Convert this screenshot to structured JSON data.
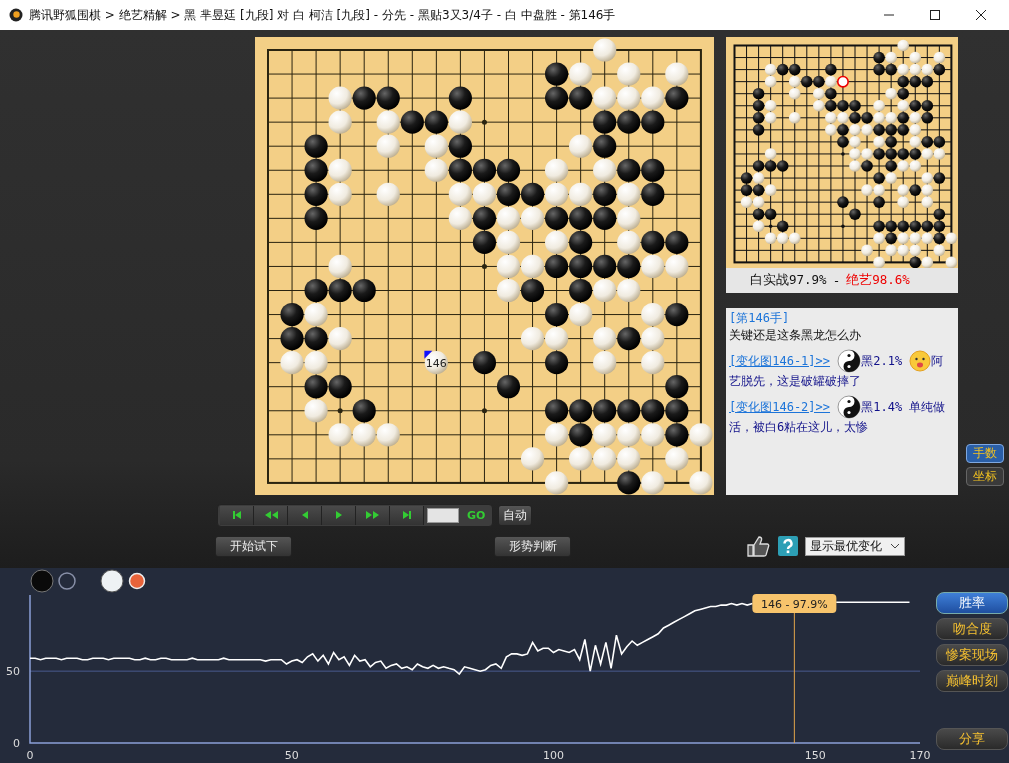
{
  "window": {
    "title": "腾讯野狐围棋 > 绝艺精解 > 黑 芈昱廷 [九段] 对 白 柯洁 [九段] - 分先 - 黑贴3又3/4子 - 白 中盘胜 - 第146手"
  },
  "board": {
    "last_move_label": "146",
    "rows": [
      {
        "cells": [
          {
            "kind": "e"
          },
          {
            "kind": "e"
          },
          {
            "kind": "e"
          },
          {
            "kind": "e"
          },
          {
            "kind": "e"
          },
          {
            "kind": "e"
          },
          {
            "kind": "e"
          },
          {
            "kind": "e"
          },
          {
            "kind": "e"
          },
          {
            "kind": "e"
          },
          {
            "kind": "e"
          },
          {
            "kind": "e"
          },
          {
            "kind": "e"
          },
          {
            "kind": "e"
          },
          {
            "kind": "w"
          },
          {
            "kind": "e"
          },
          {
            "kind": "e"
          },
          {
            "kind": "e"
          },
          {
            "kind": "e"
          }
        ]
      },
      {
        "cells": [
          {
            "kind": "e"
          },
          {
            "kind": "e"
          },
          {
            "kind": "e"
          },
          {
            "kind": "e"
          },
          {
            "kind": "e"
          },
          {
            "kind": "e"
          },
          {
            "kind": "e"
          },
          {
            "kind": "e"
          },
          {
            "kind": "e"
          },
          {
            "kind": "e"
          },
          {
            "kind": "e"
          },
          {
            "kind": "e"
          },
          {
            "kind": "b"
          },
          {
            "kind": "w"
          },
          {
            "kind": "e"
          },
          {
            "kind": "w"
          },
          {
            "kind": "e"
          },
          {
            "kind": "w"
          },
          {
            "kind": "e"
          }
        ]
      },
      {
        "cells": [
          {
            "kind": "e"
          },
          {
            "kind": "e"
          },
          {
            "kind": "e"
          },
          {
            "kind": "w"
          },
          {
            "kind": "b"
          },
          {
            "kind": "b"
          },
          {
            "kind": "e"
          },
          {
            "kind": "e"
          },
          {
            "kind": "b"
          },
          {
            "kind": "e"
          },
          {
            "kind": "e"
          },
          {
            "kind": "e"
          },
          {
            "kind": "b"
          },
          {
            "kind": "b"
          },
          {
            "kind": "w"
          },
          {
            "kind": "w"
          },
          {
            "kind": "w"
          },
          {
            "kind": "b"
          },
          {
            "kind": "e"
          }
        ]
      },
      {
        "cells": [
          {
            "kind": "e"
          },
          {
            "kind": "e"
          },
          {
            "kind": "e"
          },
          {
            "kind": "w"
          },
          {
            "kind": "e"
          },
          {
            "kind": "w"
          },
          {
            "kind": "b"
          },
          {
            "kind": "b"
          },
          {
            "kind": "w"
          },
          {
            "kind": "x"
          },
          {
            "kind": "e"
          },
          {
            "kind": "e"
          },
          {
            "kind": "e"
          },
          {
            "kind": "e"
          },
          {
            "kind": "b"
          },
          {
            "kind": "b"
          },
          {
            "kind": "b"
          },
          {
            "kind": "e"
          },
          {
            "kind": "e"
          }
        ]
      },
      {
        "cells": [
          {
            "kind": "e"
          },
          {
            "kind": "e"
          },
          {
            "kind": "b"
          },
          {
            "kind": "e"
          },
          {
            "kind": "e"
          },
          {
            "kind": "w"
          },
          {
            "kind": "e"
          },
          {
            "kind": "w"
          },
          {
            "kind": "b"
          },
          {
            "kind": "e"
          },
          {
            "kind": "e"
          },
          {
            "kind": "e"
          },
          {
            "kind": "e"
          },
          {
            "kind": "w"
          },
          {
            "kind": "b"
          },
          {
            "kind": "e"
          },
          {
            "kind": "e"
          },
          {
            "kind": "e"
          },
          {
            "kind": "e"
          }
        ]
      },
      {
        "cells": [
          {
            "kind": "e"
          },
          {
            "kind": "e"
          },
          {
            "kind": "b"
          },
          {
            "kind": "w"
          },
          {
            "kind": "e"
          },
          {
            "kind": "e"
          },
          {
            "kind": "e"
          },
          {
            "kind": "w"
          },
          {
            "kind": "b"
          },
          {
            "kind": "b"
          },
          {
            "kind": "b"
          },
          {
            "kind": "e"
          },
          {
            "kind": "w"
          },
          {
            "kind": "e"
          },
          {
            "kind": "w"
          },
          {
            "kind": "b"
          },
          {
            "kind": "b"
          },
          {
            "kind": "e"
          },
          {
            "kind": "e"
          }
        ]
      },
      {
        "cells": [
          {
            "kind": "e"
          },
          {
            "kind": "e"
          },
          {
            "kind": "b"
          },
          {
            "kind": "w"
          },
          {
            "kind": "e"
          },
          {
            "kind": "w"
          },
          {
            "kind": "e"
          },
          {
            "kind": "e"
          },
          {
            "kind": "w"
          },
          {
            "kind": "w"
          },
          {
            "kind": "b"
          },
          {
            "kind": "b"
          },
          {
            "kind": "w"
          },
          {
            "kind": "w"
          },
          {
            "kind": "b"
          },
          {
            "kind": "w"
          },
          {
            "kind": "b"
          },
          {
            "kind": "e"
          },
          {
            "kind": "e"
          }
        ]
      },
      {
        "cells": [
          {
            "kind": "e"
          },
          {
            "kind": "e"
          },
          {
            "kind": "b"
          },
          {
            "kind": "e"
          },
          {
            "kind": "e"
          },
          {
            "kind": "e"
          },
          {
            "kind": "e"
          },
          {
            "kind": "e"
          },
          {
            "kind": "w"
          },
          {
            "kind": "b"
          },
          {
            "kind": "w"
          },
          {
            "kind": "w"
          },
          {
            "kind": "b"
          },
          {
            "kind": "b"
          },
          {
            "kind": "b"
          },
          {
            "kind": "w"
          },
          {
            "kind": "e"
          },
          {
            "kind": "e"
          },
          {
            "kind": "e"
          }
        ]
      },
      {
        "cells": [
          {
            "kind": "e"
          },
          {
            "kind": "e"
          },
          {
            "kind": "e"
          },
          {
            "kind": "e"
          },
          {
            "kind": "e"
          },
          {
            "kind": "e"
          },
          {
            "kind": "e"
          },
          {
            "kind": "e"
          },
          {
            "kind": "e"
          },
          {
            "kind": "b"
          },
          {
            "kind": "w"
          },
          {
            "kind": "e"
          },
          {
            "kind": "w"
          },
          {
            "kind": "b"
          },
          {
            "kind": "e"
          },
          {
            "kind": "w"
          },
          {
            "kind": "b"
          },
          {
            "kind": "b"
          },
          {
            "kind": "e"
          }
        ]
      },
      {
        "cells": [
          {
            "kind": "e"
          },
          {
            "kind": "e"
          },
          {
            "kind": "e"
          },
          {
            "kind": "w"
          },
          {
            "kind": "e"
          },
          {
            "kind": "e"
          },
          {
            "kind": "e"
          },
          {
            "kind": "e"
          },
          {
            "kind": "e"
          },
          {
            "kind": "e"
          },
          {
            "kind": "w"
          },
          {
            "kind": "w"
          },
          {
            "kind": "b"
          },
          {
            "kind": "b"
          },
          {
            "kind": "b"
          },
          {
            "kind": "b"
          },
          {
            "kind": "w"
          },
          {
            "kind": "w"
          },
          {
            "kind": "e"
          }
        ]
      },
      {
        "cells": [
          {
            "kind": "e"
          },
          {
            "kind": "e"
          },
          {
            "kind": "b"
          },
          {
            "kind": "b"
          },
          {
            "kind": "b"
          },
          {
            "kind": "e"
          },
          {
            "kind": "e"
          },
          {
            "kind": "e"
          },
          {
            "kind": "e"
          },
          {
            "kind": "e"
          },
          {
            "kind": "w"
          },
          {
            "kind": "b"
          },
          {
            "kind": "e"
          },
          {
            "kind": "b"
          },
          {
            "kind": "w"
          },
          {
            "kind": "w"
          },
          {
            "kind": "e"
          },
          {
            "kind": "e"
          },
          {
            "kind": "e"
          }
        ]
      },
      {
        "cells": [
          {
            "kind": "e"
          },
          {
            "kind": "b"
          },
          {
            "kind": "w"
          },
          {
            "kind": "e"
          },
          {
            "kind": "e"
          },
          {
            "kind": "e"
          },
          {
            "kind": "e"
          },
          {
            "kind": "e"
          },
          {
            "kind": "e"
          },
          {
            "kind": "e"
          },
          {
            "kind": "e"
          },
          {
            "kind": "e"
          },
          {
            "kind": "b"
          },
          {
            "kind": "w"
          },
          {
            "kind": "e"
          },
          {
            "kind": "e"
          },
          {
            "kind": "w"
          },
          {
            "kind": "b"
          },
          {
            "kind": "e"
          }
        ]
      },
      {
        "cells": [
          {
            "kind": "e"
          },
          {
            "kind": "b"
          },
          {
            "kind": "b"
          },
          {
            "kind": "w"
          },
          {
            "kind": "e"
          },
          {
            "kind": "e"
          },
          {
            "kind": "e"
          },
          {
            "kind": "e"
          },
          {
            "kind": "e"
          },
          {
            "kind": "e"
          },
          {
            "kind": "e"
          },
          {
            "kind": "w"
          },
          {
            "kind": "w"
          },
          {
            "kind": "e"
          },
          {
            "kind": "w"
          },
          {
            "kind": "b"
          },
          {
            "kind": "w"
          },
          {
            "kind": "e"
          },
          {
            "kind": "e"
          }
        ]
      },
      {
        "cells": [
          {
            "kind": "e"
          },
          {
            "kind": "w"
          },
          {
            "kind": "w"
          },
          {
            "kind": "e"
          },
          {
            "kind": "e"
          },
          {
            "kind": "e"
          },
          {
            "kind": "e"
          },
          {
            "kind": "L"
          },
          {
            "kind": "e"
          },
          {
            "kind": "b"
          },
          {
            "kind": "e"
          },
          {
            "kind": "e"
          },
          {
            "kind": "b"
          },
          {
            "kind": "e"
          },
          {
            "kind": "w"
          },
          {
            "kind": "e"
          },
          {
            "kind": "w"
          },
          {
            "kind": "e"
          },
          {
            "kind": "e"
          }
        ]
      },
      {
        "cells": [
          {
            "kind": "e"
          },
          {
            "kind": "e"
          },
          {
            "kind": "b"
          },
          {
            "kind": "b"
          },
          {
            "kind": "e"
          },
          {
            "kind": "e"
          },
          {
            "kind": "e"
          },
          {
            "kind": "e"
          },
          {
            "kind": "e"
          },
          {
            "kind": "e"
          },
          {
            "kind": "b"
          },
          {
            "kind": "e"
          },
          {
            "kind": "e"
          },
          {
            "kind": "e"
          },
          {
            "kind": "e"
          },
          {
            "kind": "e"
          },
          {
            "kind": "e"
          },
          {
            "kind": "b"
          },
          {
            "kind": "e"
          }
        ]
      },
      {
        "cells": [
          {
            "kind": "e"
          },
          {
            "kind": "e"
          },
          {
            "kind": "w"
          },
          {
            "kind": "e"
          },
          {
            "kind": "b"
          },
          {
            "kind": "e"
          },
          {
            "kind": "e"
          },
          {
            "kind": "e"
          },
          {
            "kind": "e"
          },
          {
            "kind": "e"
          },
          {
            "kind": "e"
          },
          {
            "kind": "e"
          },
          {
            "kind": "b"
          },
          {
            "kind": "b"
          },
          {
            "kind": "b"
          },
          {
            "kind": "b"
          },
          {
            "kind": "b"
          },
          {
            "kind": "b"
          },
          {
            "kind": "e"
          }
        ]
      },
      {
        "cells": [
          {
            "kind": "e"
          },
          {
            "kind": "e"
          },
          {
            "kind": "e"
          },
          {
            "kind": "w"
          },
          {
            "kind": "w"
          },
          {
            "kind": "w"
          },
          {
            "kind": "e"
          },
          {
            "kind": "e"
          },
          {
            "kind": "e"
          },
          {
            "kind": "e"
          },
          {
            "kind": "e"
          },
          {
            "kind": "e"
          },
          {
            "kind": "w"
          },
          {
            "kind": "b"
          },
          {
            "kind": "w"
          },
          {
            "kind": "w"
          },
          {
            "kind": "w"
          },
          {
            "kind": "b"
          },
          {
            "kind": "w"
          }
        ]
      },
      {
        "cells": [
          {
            "kind": "e"
          },
          {
            "kind": "e"
          },
          {
            "kind": "e"
          },
          {
            "kind": "e"
          },
          {
            "kind": "e"
          },
          {
            "kind": "e"
          },
          {
            "kind": "e"
          },
          {
            "kind": "e"
          },
          {
            "kind": "e"
          },
          {
            "kind": "e"
          },
          {
            "kind": "e"
          },
          {
            "kind": "w"
          },
          {
            "kind": "e"
          },
          {
            "kind": "w"
          },
          {
            "kind": "w"
          },
          {
            "kind": "w"
          },
          {
            "kind": "e"
          },
          {
            "kind": "w"
          },
          {
            "kind": "e"
          }
        ]
      },
      {
        "cells": [
          {
            "kind": "e"
          },
          {
            "kind": "e"
          },
          {
            "kind": "e"
          },
          {
            "kind": "e"
          },
          {
            "kind": "e"
          },
          {
            "kind": "e"
          },
          {
            "kind": "e"
          },
          {
            "kind": "e"
          },
          {
            "kind": "e"
          },
          {
            "kind": "e"
          },
          {
            "kind": "e"
          },
          {
            "kind": "e"
          },
          {
            "kind": "w"
          },
          {
            "kind": "e"
          },
          {
            "kind": "e"
          },
          {
            "kind": "b"
          },
          {
            "kind": "w"
          },
          {
            "kind": "e"
          },
          {
            "kind": "w"
          }
        ]
      }
    ]
  },
  "preview": {
    "actual": "白实战97.9%",
    "separator": "-",
    "ai": "绝艺98.6%"
  },
  "comment": {
    "move": "[第146手]",
    "text": "关键还是这条黑龙怎么办",
    "variations": [
      {
        "link": "[变化图146-1]>>",
        "score": "黑2.1%",
        "emoji": true,
        "note": "阿艺脱先，这是破罐破摔了"
      },
      {
        "link": "[变化图146-2]>>",
        "score": "黑1.4%",
        "emoji": false,
        "note": "单纯做活，被白6粘在这儿，太惨"
      }
    ]
  },
  "side_toggles": [
    {
      "label": "手数",
      "selected": true
    },
    {
      "label": "坐标",
      "selected": false
    }
  ],
  "nav": {
    "go": "GO",
    "auto": "自动"
  },
  "actions": {
    "try": "开始试下",
    "judge": "形势判断",
    "select": "显示最优变化"
  },
  "chart": {
    "chart_data": {
      "type": "line",
      "xlim": [
        0,
        170
      ],
      "ylim": [
        0,
        103
      ],
      "xticks": [
        0,
        50,
        100,
        150,
        170
      ],
      "yticks": [
        0,
        50
      ],
      "x": [
        0,
        1,
        2,
        3,
        4,
        5,
        6,
        7,
        8,
        9,
        10,
        11,
        12,
        13,
        14,
        15,
        16,
        17,
        18,
        19,
        20,
        21,
        22,
        23,
        24,
        25,
        26,
        27,
        28,
        29,
        30,
        31,
        32,
        33,
        34,
        35,
        36,
        37,
        38,
        39,
        40,
        41,
        42,
        43,
        44,
        45,
        46,
        47,
        48,
        49,
        50,
        51,
        52,
        53,
        54,
        55,
        56,
        57,
        58,
        59,
        60,
        61,
        62,
        63,
        64,
        65,
        66,
        67,
        68,
        69,
        70,
        71,
        72,
        73,
        74,
        75,
        76,
        77,
        78,
        79,
        80,
        81,
        82,
        83,
        84,
        85,
        86,
        87,
        88,
        89,
        90,
        91,
        92,
        93,
        94,
        95,
        96,
        97,
        98,
        99,
        100,
        101,
        102,
        103,
        104,
        105,
        106,
        107,
        108,
        109,
        110,
        111,
        112,
        113,
        114,
        115,
        116,
        117,
        118,
        119,
        120,
        121,
        122,
        123,
        124,
        125,
        126,
        127,
        128,
        129,
        130,
        131,
        132,
        133,
        134,
        135,
        136,
        137,
        138,
        139,
        140,
        141,
        142,
        143,
        144,
        145,
        146,
        147,
        148,
        149,
        150,
        151,
        152,
        153,
        154,
        155,
        156,
        157,
        158,
        159,
        160,
        161,
        162,
        163,
        164,
        165,
        166,
        167,
        168
      ],
      "series": [
        {
          "color": "#ffffff",
          "values": [
            59,
            59,
            58,
            59,
            59,
            59,
            58,
            59,
            59,
            59,
            58,
            58,
            59,
            59,
            59,
            58,
            59,
            59,
            59,
            59,
            58,
            58,
            59,
            58,
            58,
            59,
            59,
            58,
            58,
            58,
            58,
            59,
            58,
            58,
            58,
            58,
            58,
            59,
            58,
            58,
            58,
            58,
            58,
            58,
            58,
            57,
            58,
            58,
            58,
            55,
            57,
            58,
            56,
            60,
            62,
            57,
            61,
            55,
            63,
            58,
            60,
            54,
            61,
            57,
            58,
            53,
            56,
            57,
            52,
            54,
            55,
            52,
            53,
            51,
            55,
            53,
            52,
            54,
            52,
            53,
            52,
            51,
            48,
            53,
            52,
            51,
            50,
            51,
            54,
            55,
            52,
            60,
            62,
            62,
            61,
            62,
            70,
            64,
            66,
            66,
            63,
            65,
            64,
            63,
            65,
            58,
            72,
            50,
            68,
            55,
            70,
            52,
            75,
            62,
            67,
            71,
            68,
            70,
            72,
            74,
            76,
            80,
            82,
            84,
            86,
            88,
            90,
            92,
            93,
            94,
            95,
            95,
            96,
            96,
            97,
            96,
            97,
            96,
            97,
            null,
            null,
            null,
            null,
            null,
            null,
            null,
            null,
            null,
            null,
            null,
            null,
            null,
            null,
            null,
            98,
            98,
            98,
            98,
            98,
            98,
            98,
            98,
            98,
            98,
            98,
            98,
            98,
            98,
            98
          ]
        }
      ],
      "ref_lines": [
        {
          "axis": "y",
          "value": 50
        },
        {
          "axis": "x",
          "value": 146
        }
      ],
      "annotations": [
        "146 - 97.9%"
      ]
    },
    "tabs": [
      {
        "label": "胜率",
        "selected": true
      },
      {
        "label": "吻合度",
        "selected": false
      },
      {
        "label": "惨案现场",
        "selected": false
      },
      {
        "label": "巅峰时刻",
        "selected": false
      }
    ],
    "share": "分享"
  }
}
